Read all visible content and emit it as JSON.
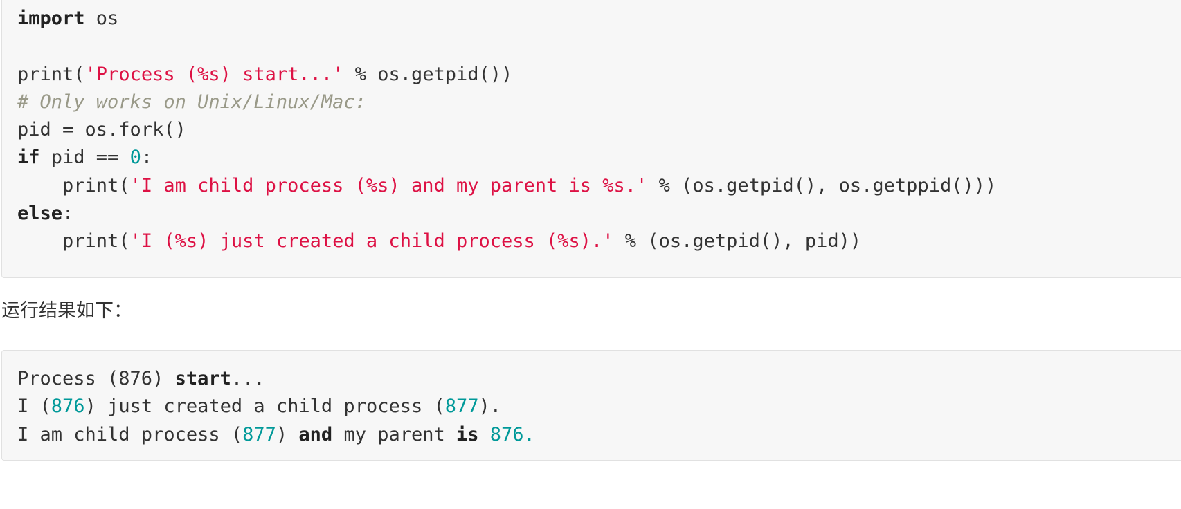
{
  "code_block_1": {
    "lines": [
      {
        "tokens": [
          {
            "text": "import",
            "kind": "kw"
          },
          {
            "text": " os",
            "kind": "plain"
          }
        ]
      },
      {
        "tokens": []
      },
      {
        "tokens": [
          {
            "text": "print(",
            "kind": "plain"
          },
          {
            "text": "'Process (%s) start...'",
            "kind": "str"
          },
          {
            "text": " % os.getpid())",
            "kind": "plain"
          }
        ]
      },
      {
        "tokens": [
          {
            "text": "# Only works on Unix/Linux/Mac:",
            "kind": "cmt"
          }
        ]
      },
      {
        "tokens": [
          {
            "text": "pid = os.fork()",
            "kind": "plain"
          }
        ]
      },
      {
        "tokens": [
          {
            "text": "if",
            "kind": "kw"
          },
          {
            "text": " pid == ",
            "kind": "plain"
          },
          {
            "text": "0",
            "kind": "num"
          },
          {
            "text": ":",
            "kind": "plain"
          }
        ]
      },
      {
        "tokens": [
          {
            "text": "    print(",
            "kind": "plain"
          },
          {
            "text": "'I am child process (%s) and my parent is %s.'",
            "kind": "str"
          },
          {
            "text": " % (os.getpid(), os.getppid()))",
            "kind": "plain"
          }
        ]
      },
      {
        "tokens": [
          {
            "text": "else",
            "kind": "kw"
          },
          {
            "text": ":",
            "kind": "plain"
          }
        ]
      },
      {
        "tokens": [
          {
            "text": "    print(",
            "kind": "plain"
          },
          {
            "text": "'I (%s) just created a child process (%s).'",
            "kind": "str"
          },
          {
            "text": " % (os.getpid(), pid))",
            "kind": "plain"
          }
        ]
      }
    ]
  },
  "result_label": "运行结果如下：",
  "code_block_2": {
    "lines": [
      {
        "tokens": [
          {
            "text": "Process (876) ",
            "kind": "plain"
          },
          {
            "text": "start",
            "kind": "b"
          },
          {
            "text": "...",
            "kind": "plain"
          }
        ]
      },
      {
        "tokens": [
          {
            "text": "I (",
            "kind": "plain"
          },
          {
            "text": "876",
            "kind": "num"
          },
          {
            "text": ") just created a child process (",
            "kind": "plain"
          },
          {
            "text": "877",
            "kind": "num"
          },
          {
            "text": ").",
            "kind": "plain"
          }
        ]
      },
      {
        "tokens": [
          {
            "text": "I am child process (",
            "kind": "plain"
          },
          {
            "text": "877",
            "kind": "num"
          },
          {
            "text": ") ",
            "kind": "plain"
          },
          {
            "text": "and",
            "kind": "b"
          },
          {
            "text": " my parent ",
            "kind": "plain"
          },
          {
            "text": "is",
            "kind": "b"
          },
          {
            "text": " ",
            "kind": "plain"
          },
          {
            "text": "876.",
            "kind": "num"
          }
        ]
      }
    ]
  }
}
